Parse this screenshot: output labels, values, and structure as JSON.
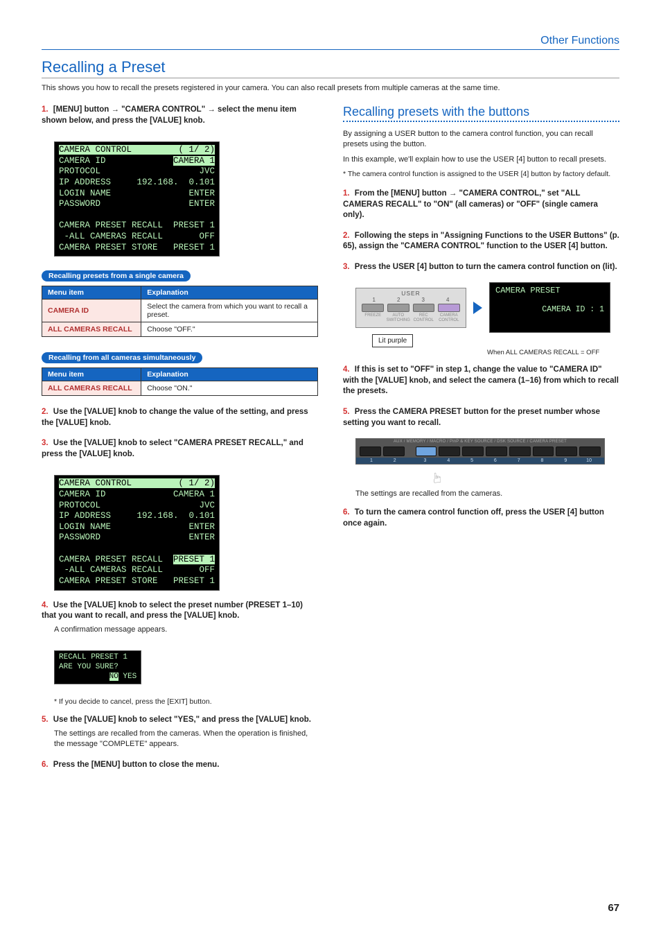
{
  "header": {
    "section": "Other Functions"
  },
  "title": "Recalling a Preset",
  "intro": "This shows you how to recall the presets registered in your camera. You can also recall presets from multiple cameras at the same time.",
  "left": {
    "step1": "[MENU] button → \"CAMERA CONTROL\" → select the menu item shown below, and press the [VALUE] knob.",
    "lcd1": {
      "title": "CAMERA CONTROL",
      "page": "( 1/ 2)",
      "rows": [
        [
          "CAMERA ID",
          "CAMERA 1"
        ],
        [
          "PROTOCOL",
          "JVC"
        ],
        [
          "IP ADDRESS",
          "192.168.  0.101"
        ],
        [
          "LOGIN NAME",
          "ENTER"
        ],
        [
          "PASSWORD",
          "ENTER"
        ],
        [
          "",
          ""
        ],
        [
          "CAMERA PRESET RECALL",
          "PRESET 1"
        ],
        [
          " -ALL CAMERAS RECALL",
          "OFF"
        ],
        [
          "CAMERA PRESET STORE",
          "PRESET 1"
        ]
      ],
      "hl_row": 1
    },
    "pill1": "Recalling presets from a single camera",
    "table1": {
      "hdr": [
        "Menu item",
        "Explanation"
      ],
      "rows": [
        [
          "CAMERA ID",
          "Select the camera from which you want to recall a preset."
        ],
        [
          "ALL CAMERAS RECALL",
          "Choose \"OFF.\""
        ]
      ]
    },
    "pill2": "Recalling from all cameras simultaneously",
    "table2": {
      "hdr": [
        "Menu item",
        "Explanation"
      ],
      "rows": [
        [
          "ALL CAMERAS RECALL",
          "Choose \"ON.\""
        ]
      ]
    },
    "step2": "Use the [VALUE] knob to change the value of the setting, and press the [VALUE] knob.",
    "step3": "Use the [VALUE] knob to select \"CAMERA PRESET RECALL,\" and press the [VALUE] knob.",
    "lcd2_hl_row": 7,
    "step4": "Use the [VALUE] knob to select the preset number (PRESET 1–10) that you want to recall, and press the [VALUE] knob.",
    "step4_body": "A confirmation message appears.",
    "lcd3": {
      "l1": "RECALL PRESET 1",
      "l2": "ARE YOU SURE?",
      "no": "NO",
      "yes": " YES"
    },
    "note4": "* If you decide to cancel, press the [EXIT] button.",
    "step5": "Use the [VALUE] knob to select \"YES,\" and press the [VALUE] knob.",
    "step5_body": "The settings are recalled from the cameras. When the operation is finished, the message \"COMPLETE\" appears.",
    "step6": "Press the [MENU] button to close the menu."
  },
  "right": {
    "title": "Recalling presets with the buttons",
    "p1": "By assigning a USER button to the camera control function, you can recall presets using the button.",
    "p2": "In this example, we'll explain how to use the USER [4] button to recall presets.",
    "note1": "* The camera control function is assigned to the USER [4] button by factory default.",
    "step1": "From the [MENU] button → \"CAMERA CONTROL,\" set \"ALL CAMERAS RECALL\" to \"ON\" (all cameras) or \"OFF\" (single camera only).",
    "step2": "Following the steps in \"Assigning Functions to the USER Buttons\" (p. 65), assign the \"CAMERA CONTROL\" function to the USER [4] button.",
    "step3": "Press the USER [4] button to turn the camera control function on (lit).",
    "user_panel": {
      "title": "USER",
      "nums": [
        "1",
        "2",
        "3",
        "4"
      ],
      "labels": [
        "FREEZE",
        "AUTO\nSWITCHING",
        "REC\nCONTROL",
        "CAMERA\nCONTROL"
      ]
    },
    "callout": "Lit purple",
    "lcd_preset": {
      "hdr": "CAMERA PRESET",
      "val": "CAMERA ID :   1"
    },
    "caption": "When ALL CAMERAS RECALL = OFF",
    "step4": "If this is set to \"OFF\" in step 1, change the value to \"CAMERA ID\" with the [VALUE] knob, and select the camera (1–16) from which to recall the presets.",
    "step5": "Press the CAMERA PRESET button for the preset number whose setting you want to recall.",
    "strip_label": "AUX / MEMORY / MACRO / PinP & KEY SOURCE / DSK SOURCE / CAMERA PRESET",
    "strip_nums": [
      "1",
      "2",
      "3",
      "4",
      "5",
      "6",
      "7",
      "8",
      "9",
      "10"
    ],
    "step5_body": "The settings are recalled from the cameras.",
    "step6": "To turn the camera control function off, press the USER [4] button once again."
  },
  "page_number": "67"
}
